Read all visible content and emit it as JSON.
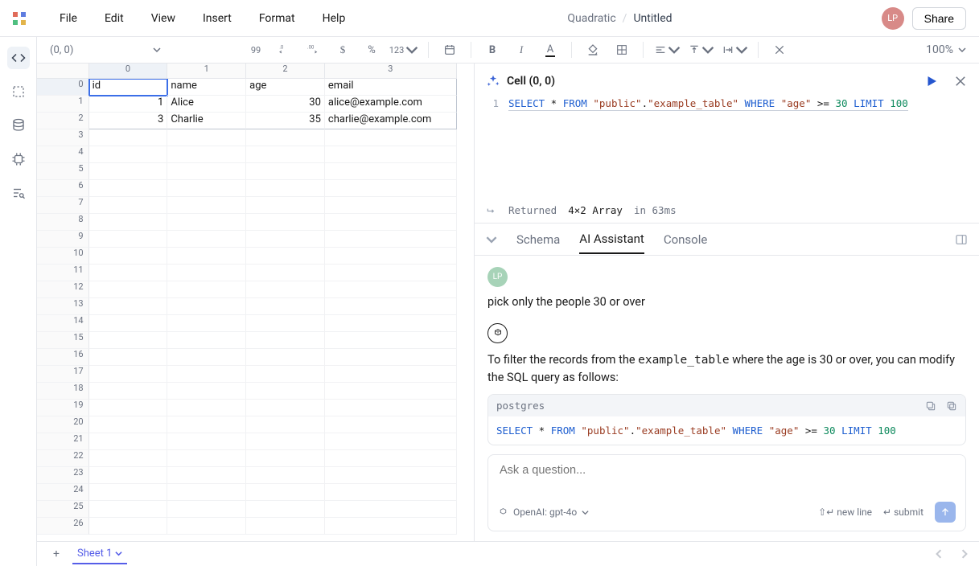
{
  "menubar": {
    "items": [
      "File",
      "Edit",
      "View",
      "Insert",
      "Format",
      "Help"
    ],
    "appname": "Quadratic",
    "separator": "/",
    "docname": "Untitled",
    "avatar": "LP",
    "share": "Share"
  },
  "toolbar": {
    "cellref": "(0, 0)",
    "num_format_label": "99",
    "auto_label": "123",
    "zoom": "100%"
  },
  "grid": {
    "col_headers": [
      "0",
      "1",
      "2",
      "3"
    ],
    "row_count": 27,
    "data": [
      [
        "id",
        "name",
        "age",
        "email"
      ],
      [
        "1",
        "Alice",
        "30",
        "alice@example.com"
      ],
      [
        "3",
        "Charlie",
        "35",
        "charlie@example.com"
      ]
    ]
  },
  "sheet": {
    "name": "Sheet 1"
  },
  "code": {
    "title": "Cell (0, 0)",
    "line_no": "1",
    "tokens": [
      "SELECT",
      " * ",
      "FROM",
      " ",
      "\"public\"",
      ".",
      "\"example_table\"",
      " ",
      "WHERE",
      " ",
      "\"age\"",
      " >= ",
      "30",
      " ",
      "LIMIT",
      " ",
      "100"
    ],
    "returned_label": "Returned",
    "returned_value": "4×2 Array",
    "returned_time": "in 63ms"
  },
  "tabs": {
    "schema": "Schema",
    "ai": "AI Assistant",
    "console": "Console"
  },
  "chat": {
    "user_avatar": "LP",
    "user_msg": "pick only the people 30 or over",
    "ai_msg_pre": "To filter the records from the ",
    "ai_msg_code": "example_table",
    "ai_msg_post": " where the age is 30 or over, you can modify the SQL query as follows:",
    "codeblock_lang": "postgres",
    "codeblock_tokens": [
      "SELECT",
      " * ",
      "FROM",
      " ",
      "\"public\"",
      ".",
      "\"example_table\"",
      " ",
      "WHERE",
      " ",
      "\"age\"",
      " >= ",
      "30",
      " ",
      "LIMIT",
      " ",
      "100"
    ]
  },
  "ask": {
    "placeholder": "Ask a question...",
    "model": "OpenAI: gpt-4o",
    "newline_hint": "new line",
    "submit_hint": "submit"
  }
}
